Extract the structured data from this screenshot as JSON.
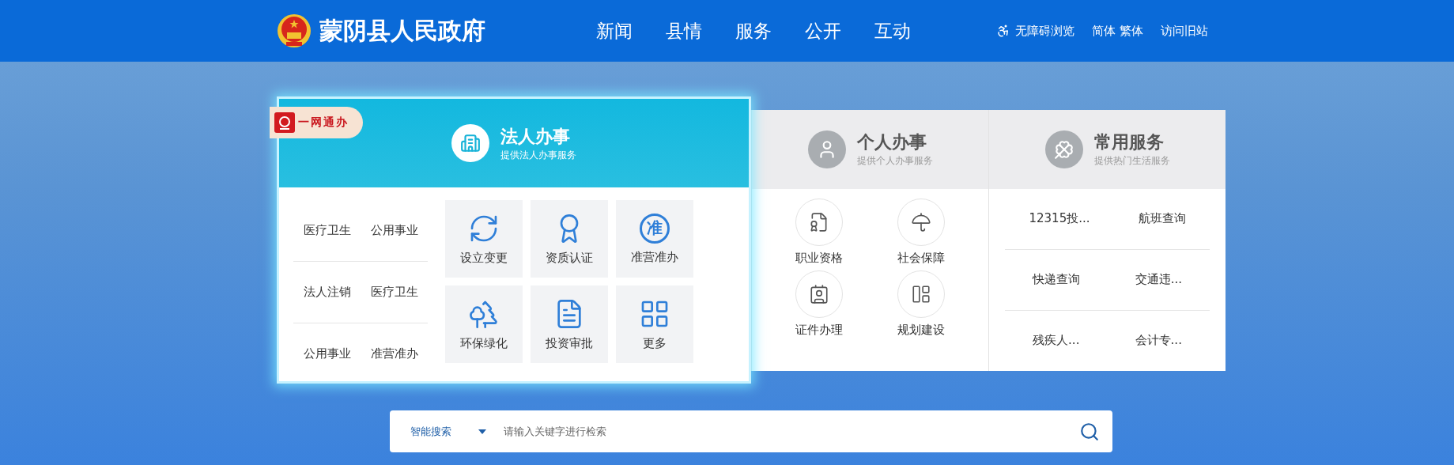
{
  "header": {
    "site_title": "蒙阴县人民政府",
    "nav": [
      "新闻",
      "县情",
      "服务",
      "公开",
      "互动"
    ],
    "accessibility": "无障碍浏览",
    "languages": [
      "简体",
      "繁体"
    ],
    "old_site": "访问旧站"
  },
  "badge": {
    "title": "一网通办"
  },
  "panels": [
    {
      "kind": "legal",
      "selected": true,
      "title": "法人办事",
      "subtitle": "提供法人办事服务",
      "categories": [
        [
          "医疗卫生",
          "公用事业"
        ],
        [
          "法人注销",
          "医疗卫生"
        ],
        [
          "公用事业",
          "准营准办"
        ]
      ],
      "tiles": [
        {
          "label": "设立变更"
        },
        {
          "label": "资质认证"
        },
        {
          "label": "准营准办",
          "icon_text": "准"
        },
        {
          "label": "环保绿化"
        },
        {
          "label": "投资审批"
        },
        {
          "label": "更多"
        }
      ]
    },
    {
      "kind": "personal",
      "selected": false,
      "title": "个人办事",
      "subtitle": "提供个人办事服务",
      "items": [
        "职业资格",
        "社会保障",
        "证件办理",
        "规划建设"
      ]
    },
    {
      "kind": "links",
      "selected": false,
      "title": "常用服务",
      "subtitle": "提供热门生活服务",
      "links": [
        [
          "12315投...",
          "航班查询"
        ],
        [
          "快递查询",
          "交通违..."
        ],
        [
          "残疾人...",
          "会计专..."
        ]
      ]
    }
  ],
  "search": {
    "scope": "智能搜索",
    "placeholder": "请输入关键字进行检索"
  }
}
